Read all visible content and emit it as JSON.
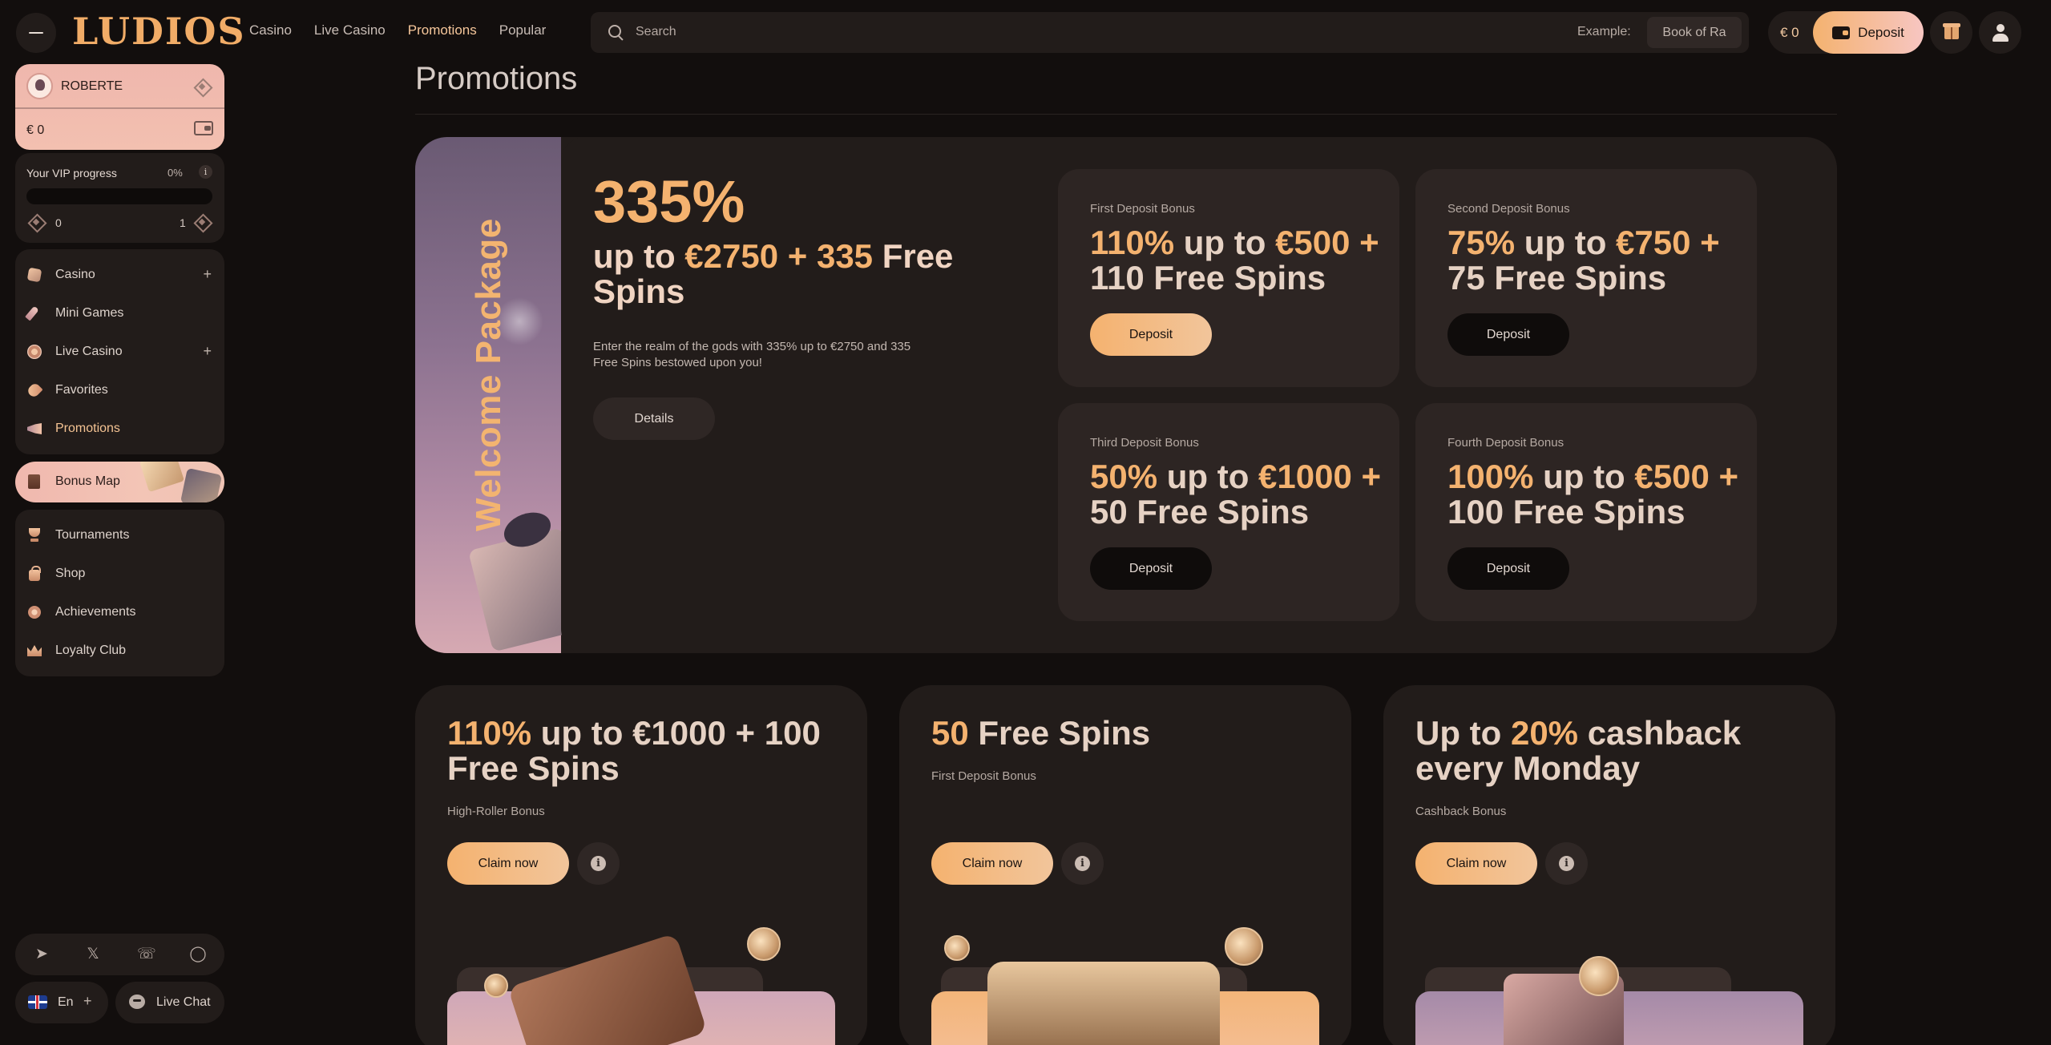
{
  "topbar": {
    "logo": "LUDIOS",
    "nav": [
      {
        "label": "Casino",
        "active": false
      },
      {
        "label": "Live Casino",
        "active": false
      },
      {
        "label": "Promotions",
        "active": true
      },
      {
        "label": "Popular",
        "active": false
      }
    ],
    "search": {
      "placeholder": "Search",
      "example_label": "Example:",
      "example_value": "Book of Ra"
    },
    "balance": "€ 0",
    "deposit_label": "Deposit"
  },
  "sidebar": {
    "user": {
      "name": "ROBERTE",
      "balance": "€ 0"
    },
    "vip": {
      "title": "Your VIP progress",
      "percent": "0%",
      "info": "i",
      "level_from": "0",
      "level_to": "1",
      "progress": 0
    },
    "nav_group1": [
      {
        "label": "Casino",
        "icon": "casino-cube-icon",
        "expandable": true
      },
      {
        "label": "Mini Games",
        "icon": "rocket-icon",
        "expandable": false
      },
      {
        "label": "Live Casino",
        "icon": "casino-chip-icon",
        "expandable": true
      },
      {
        "label": "Favorites",
        "icon": "heart-icon",
        "expandable": false
      },
      {
        "label": "Promotions",
        "icon": "megaphone-icon",
        "expandable": false,
        "active": true
      }
    ],
    "bonus_map": {
      "label": "Bonus Map"
    },
    "nav_group2": [
      {
        "label": "Tournaments",
        "icon": "trophy-icon"
      },
      {
        "label": "Shop",
        "icon": "shopping-bag-icon"
      },
      {
        "label": "Achievements",
        "icon": "medal-icon"
      },
      {
        "label": "Loyalty Club",
        "icon": "crown-icon"
      }
    ],
    "social": [
      "telegram-icon",
      "x-icon",
      "whatsapp-icon",
      "instagram-icon"
    ],
    "language": {
      "label": "En",
      "plus": "+"
    },
    "chat_label": "Live Chat",
    "plus": "+"
  },
  "main": {
    "title": "Promotions",
    "welcome": {
      "vertical_label": "Welcome Package",
      "percent": "335%",
      "subtitle_prefix": "up to ",
      "subtitle_highlight": "€2750 + 335",
      "subtitle_suffix": " Free Spins",
      "description": "Enter the realm of the gods with 335% up to €2750 and 335 Free Spins bestowed upon you!",
      "details_label": "Details"
    },
    "deposit_bonuses": [
      {
        "label": "First Deposit Bonus",
        "title_highlight": "110%",
        "title_mid": " up to ",
        "title_highlight2": "€500 +",
        "title_rest": "110 Free Spins",
        "button": "Deposit",
        "primary": true
      },
      {
        "label": "Second Deposit Bonus",
        "title_highlight": "75%",
        "title_mid": " up to ",
        "title_highlight2": "€750 +",
        "title_rest": "75 Free Spins",
        "button": "Deposit",
        "primary": false
      },
      {
        "label": "Third Deposit Bonus",
        "title_highlight": "50%",
        "title_mid": " up to ",
        "title_highlight2": "€1000 +",
        "title_rest": "50 Free Spins",
        "button": "Deposit",
        "primary": false
      },
      {
        "label": "Fourth Deposit Bonus",
        "title_highlight": "100%",
        "title_mid": " up to ",
        "title_highlight2": "€500 +",
        "title_rest": "100 Free Spins",
        "button": "Deposit",
        "primary": false
      }
    ],
    "promos": [
      {
        "title_highlight": "110%",
        "title_rest": " up to €1000 + 100 Free Spins",
        "subtitle": "High-Roller Bonus",
        "button": "Claim now",
        "info": "i"
      },
      {
        "title_highlight": "50",
        "title_rest": " Free Spins",
        "subtitle": "First Deposit Bonus",
        "button": "Claim now",
        "info": "i"
      },
      {
        "title_highlight": "20%",
        "title_prefix": "Up to ",
        "title_rest": " cashback every Monday",
        "subtitle": "Cashback Bonus",
        "button": "Claim now",
        "info": "i"
      }
    ]
  },
  "colors": {
    "background": "#120e0d",
    "card": "#221c1a",
    "accent": "#f4b26f",
    "accent_pink": "#f3c0b0"
  }
}
